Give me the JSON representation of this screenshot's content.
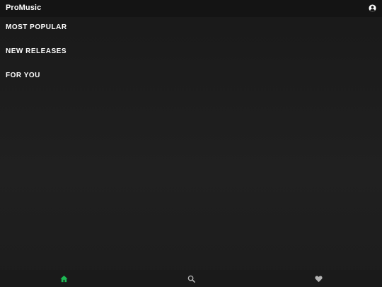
{
  "app": {
    "title": "ProMusic"
  },
  "header": {
    "account_icon": "account-circle-icon"
  },
  "sections": [
    {
      "label": "MOST POPULAR"
    },
    {
      "label": "NEW RELEASES"
    },
    {
      "label": "FOR YOU"
    }
  ],
  "bottom_nav": {
    "items": [
      {
        "icon": "home-icon",
        "active": true
      },
      {
        "icon": "search-icon",
        "active": false
      },
      {
        "icon": "heart-icon",
        "active": false
      }
    ]
  },
  "colors": {
    "background": "#1e1e1e",
    "header": "#141414",
    "text": "#ffffff",
    "accent": "#1db954",
    "inactive_icon": "#b3b3b3"
  }
}
